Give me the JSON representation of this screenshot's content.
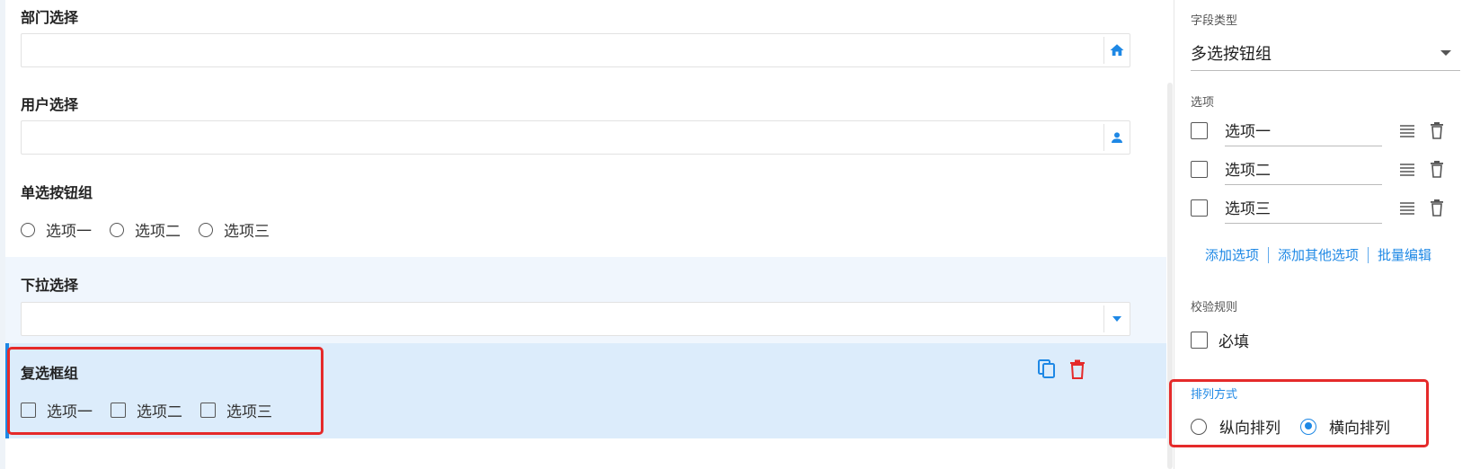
{
  "left": {
    "dept": {
      "label": "部门选择",
      "icon": "home-icon"
    },
    "user": {
      "label": "用户选择",
      "icon": "person-icon"
    },
    "radio_group": {
      "label": "单选按钮组",
      "options": [
        "选项一",
        "选项二",
        "选项三"
      ]
    },
    "dropdown": {
      "label": "下拉选择",
      "icon": "dropdown-caret-icon"
    },
    "checkbox_group": {
      "label": "复选框组",
      "options": [
        "选项一",
        "选项二",
        "选项三"
      ]
    }
  },
  "right": {
    "field_type": {
      "label": "字段类型",
      "value": "多选按钮组"
    },
    "options": {
      "label": "选项",
      "items": [
        "选项一",
        "选项二",
        "选项三"
      ]
    },
    "links": {
      "add_option": "添加选项",
      "add_other": "添加其他选项",
      "batch_edit": "批量编辑"
    },
    "validation": {
      "label": "校验规则",
      "required": "必填"
    },
    "layout": {
      "label": "排列方式",
      "vertical": "纵向排列",
      "horizontal": "横向排列",
      "selected": "horizontal"
    }
  },
  "colors": {
    "accent": "#1e88e5",
    "danger": "#e52a2a",
    "selected_bg": "#dcecfb",
    "hover_bg": "#f0f6fd"
  }
}
